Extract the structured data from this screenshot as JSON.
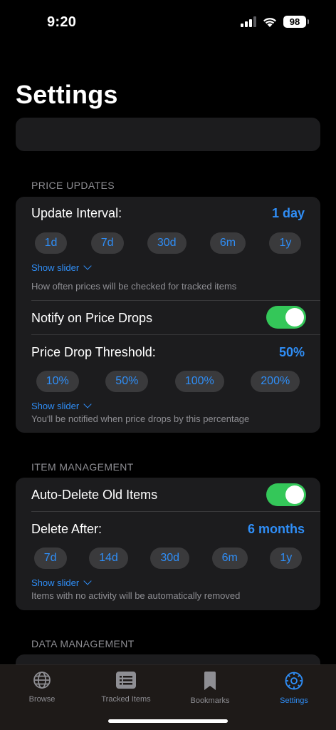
{
  "status": {
    "time": "9:20",
    "battery": "98"
  },
  "title": "Settings",
  "price_updates": {
    "header": "PRICE UPDATES",
    "update_interval": {
      "label": "Update Interval:",
      "value": "1 day",
      "chips": [
        "1d",
        "7d",
        "30d",
        "6m",
        "1y"
      ],
      "show_slider": "Show slider",
      "footnote": "How often prices will be checked for tracked items"
    },
    "notify": {
      "label": "Notify on Price Drops",
      "enabled": true
    },
    "threshold": {
      "label": "Price Drop Threshold:",
      "value": "50%",
      "chips": [
        "10%",
        "50%",
        "100%",
        "200%"
      ],
      "show_slider": "Show slider",
      "footnote": "You'll be notified when price drops by this percentage"
    }
  },
  "item_management": {
    "header": "ITEM MANAGEMENT",
    "auto_delete": {
      "label": "Auto-Delete Old Items",
      "enabled": true
    },
    "delete_after": {
      "label": "Delete After:",
      "value": "6 months",
      "chips": [
        "7d",
        "14d",
        "30d",
        "6m",
        "1y"
      ],
      "show_slider": "Show slider",
      "footnote": "Items with no activity will be automatically removed"
    }
  },
  "data_management": {
    "header": "DATA MANAGEMENT"
  },
  "tabs": [
    {
      "label": "Browse",
      "icon": "globe-icon"
    },
    {
      "label": "Tracked Items",
      "icon": "list-icon"
    },
    {
      "label": "Bookmarks",
      "icon": "bookmark-icon"
    },
    {
      "label": "Settings",
      "icon": "gear-icon",
      "active": true
    }
  ],
  "colors": {
    "accent": "#2f8ef7",
    "toggle_on": "#34c759",
    "card": "#1c1c1e"
  }
}
